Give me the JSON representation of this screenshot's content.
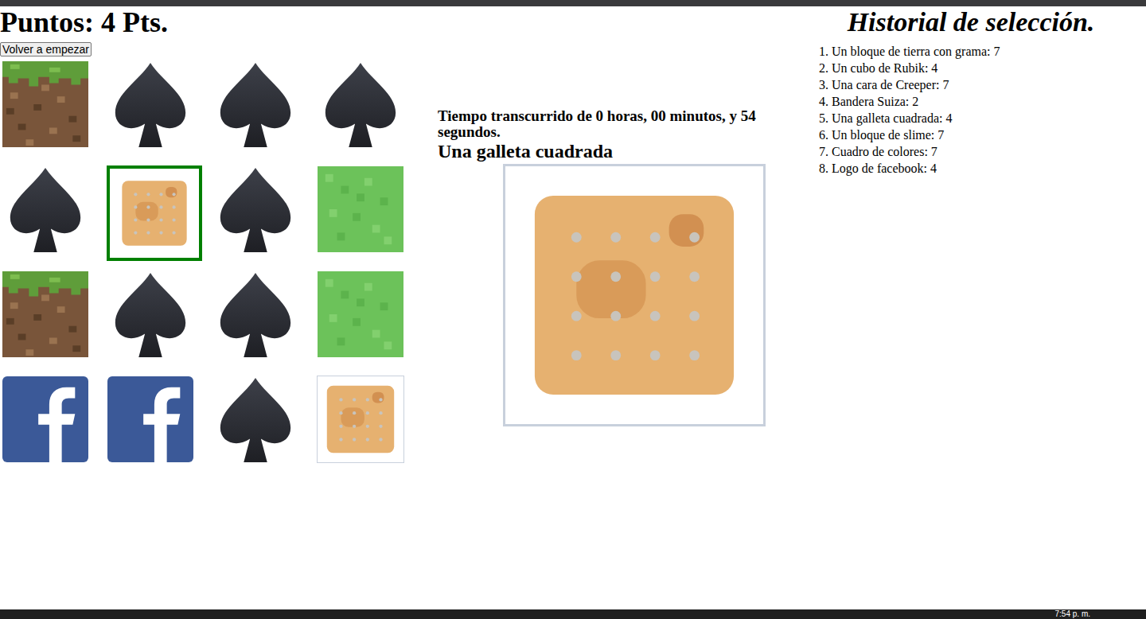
{
  "score": "Puntos: 4 Pts.",
  "restart_button": "Volver a empezar",
  "cards": [
    {
      "kind": "grass",
      "selected": false
    },
    {
      "kind": "spade",
      "selected": false
    },
    {
      "kind": "spade",
      "selected": false
    },
    {
      "kind": "spade",
      "selected": false
    },
    {
      "kind": "spade",
      "selected": false
    },
    {
      "kind": "cracker",
      "selected": true
    },
    {
      "kind": "spade",
      "selected": false
    },
    {
      "kind": "slime",
      "selected": false
    },
    {
      "kind": "grass",
      "selected": false
    },
    {
      "kind": "spade",
      "selected": false
    },
    {
      "kind": "spade",
      "selected": false
    },
    {
      "kind": "slime",
      "selected": false
    },
    {
      "kind": "facebook",
      "selected": false
    },
    {
      "kind": "facebook",
      "selected": false
    },
    {
      "kind": "spade",
      "selected": false
    },
    {
      "kind": "cracker",
      "selected": false
    }
  ],
  "timer": "Tiempo transcurrido de 0 horas, 00 minutos, y 54 segundos.",
  "selected_card": {
    "label": "Una galleta cuadrada",
    "kind": "cracker"
  },
  "history": {
    "title": "Historial de selección.",
    "items": [
      {
        "number": "1.",
        "text": "Un bloque de tierra con grama: 7"
      },
      {
        "number": "2.",
        "text": "Un cubo de Rubik: 4"
      },
      {
        "number": "3.",
        "text": "Una cara de Creeper: 7"
      },
      {
        "number": "4.",
        "text": "Bandera Suiza: 2"
      },
      {
        "number": "5.",
        "text": "Una galleta cuadrada: 4"
      },
      {
        "number": "6.",
        "text": "Un bloque de slime: 7"
      },
      {
        "number": "7.",
        "text": "Cuadro de colores: 7"
      },
      {
        "number": "8.",
        "text": "Logo de facebook: 4"
      }
    ]
  },
  "taskbar": {
    "clock": "7:54 p. m."
  }
}
